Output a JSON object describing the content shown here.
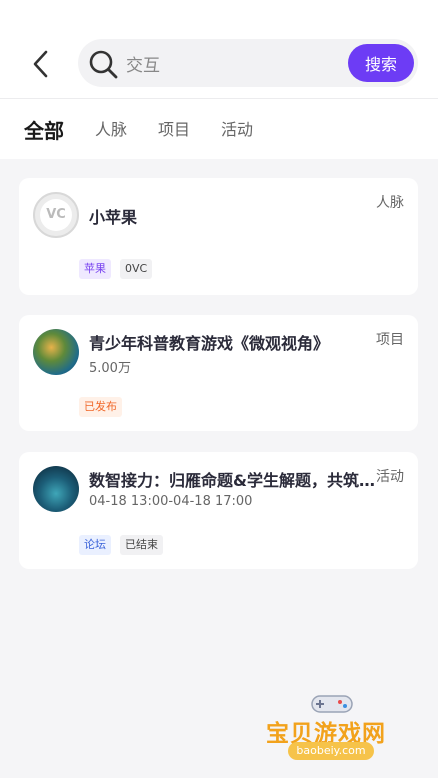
{
  "search": {
    "query": "交互",
    "button_label": "搜索"
  },
  "tabs": [
    {
      "label": "全部",
      "active": true
    },
    {
      "label": "人脉",
      "active": false
    },
    {
      "label": "项目",
      "active": false
    },
    {
      "label": "活动",
      "active": false
    }
  ],
  "results": [
    {
      "title": "小苹果",
      "type": "人脉",
      "avatar_text": "VC",
      "tags": [
        {
          "label": "苹果",
          "style": "purple"
        },
        {
          "label": "0VC",
          "style": "grey"
        }
      ]
    },
    {
      "title": "青少年科普教育游戏《微观视角》",
      "subtitle": "5.00万",
      "type": "项目",
      "tags": [
        {
          "label": "已发布",
          "style": "orange"
        }
      ]
    },
    {
      "title": "数智接力：归雁命题&学生解题，共筑AI...",
      "subtitle": "04-18 13:00-04-18 17:00",
      "type": "活动",
      "tags": [
        {
          "label": "论坛",
          "style": "blue"
        },
        {
          "label": "已结束",
          "style": "grey"
        }
      ]
    }
  ],
  "watermark": {
    "title": "宝贝游戏网",
    "site": "baobeiy.com"
  },
  "colors": {
    "accent": "#6d3cf5",
    "tag_orange": "#f0682a",
    "tag_blue": "#3b63d9"
  }
}
